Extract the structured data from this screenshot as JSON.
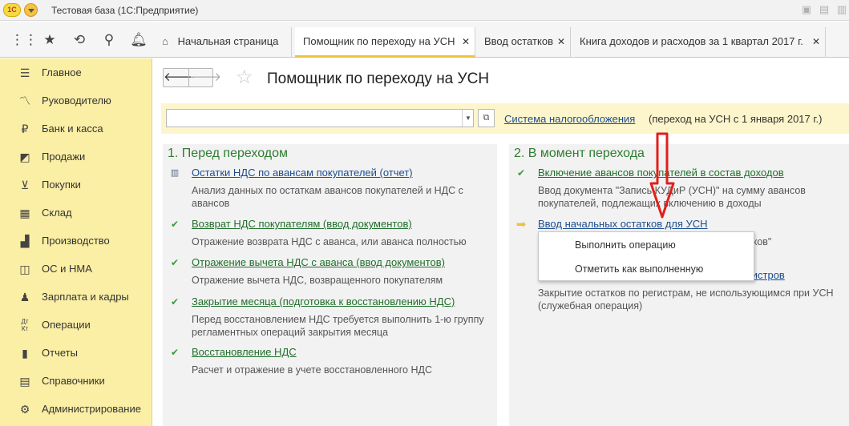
{
  "titlebar": {
    "logo": "1С",
    "title": "Тестовая база  (1С:Предприятие)"
  },
  "tabs": [
    {
      "label": "Начальная страница"
    },
    {
      "label": "Помощник по переходу на УСН"
    },
    {
      "label": "Ввод остатков"
    },
    {
      "label": "Книга доходов и расходов за 1 квартал 2017 г."
    }
  ],
  "sidebar": {
    "items": [
      {
        "label": "Главное",
        "icon": "menu-icon"
      },
      {
        "label": "Руководителю",
        "icon": "chart-line-icon"
      },
      {
        "label": "Банк и касса",
        "icon": "ruble-icon"
      },
      {
        "label": "Продажи",
        "icon": "bag-icon"
      },
      {
        "label": "Покупки",
        "icon": "cart-icon"
      },
      {
        "label": "Склад",
        "icon": "warehouse-icon"
      },
      {
        "label": "Производство",
        "icon": "factory-icon"
      },
      {
        "label": "ОС и НМА",
        "icon": "assets-icon"
      },
      {
        "label": "Зарплата и кадры",
        "icon": "people-icon"
      },
      {
        "label": "Операции",
        "icon": "dt-kt-icon"
      },
      {
        "label": "Отчеты",
        "icon": "reports-icon"
      },
      {
        "label": "Справочники",
        "icon": "book-icon"
      },
      {
        "label": "Администрирование",
        "icon": "gear-icon"
      }
    ]
  },
  "main": {
    "title": "Помощник по переходу на УСН",
    "tax_link": "Система налогообложения",
    "tax_note": "(переход на УСН с 1 января 2017 г.)",
    "left": {
      "title": "1. Перед переходом",
      "steps": [
        {
          "title": "Остатки НДС по авансам покупателей (отчет)",
          "desc": [
            "Анализ данных по остаткам авансов покупателей и НДС с",
            "авансов"
          ]
        },
        {
          "title": "Возврат НДС покупателям (ввод документов)",
          "desc": [
            "Отражение возврата НДС с аванса, или аванса полностью"
          ]
        },
        {
          "title": "Отражение вычета НДС с аванса (ввод документов)",
          "desc": [
            "Отражение вычета НДС, возвращенного покупателям"
          ]
        },
        {
          "title": "Закрытие месяца (подготовка к восстановлению НДС)",
          "desc": [
            "Перед восстановлением НДС требуется выполнить 1-ю группу",
            "регламентных операций закрытия месяца"
          ]
        },
        {
          "title": "Восстановление НДС",
          "desc": [
            "Расчет и отражение в учете восстановленного НДС"
          ]
        }
      ]
    },
    "right": {
      "title": "2. В момент перехода",
      "steps": [
        {
          "title": "Включение авансов покупателей в состав доходов",
          "desc": [
            "Ввод документа \"Запись КУДиР (УСН)\" на сумму авансов",
            "покупателей, подлежащих включению в доходы"
          ]
        },
        {
          "title": "Ввод начальных остатков для УСН",
          "desc_tail": "тков\""
        },
        {
          "title_tail": "гистров",
          "desc": [
            "Закрытие остатков по  регистрам, не использующимся при УСН",
            "(служебная операция)"
          ]
        }
      ]
    },
    "popup": [
      "Выполнить операцию",
      "Отметить как выполненную"
    ]
  },
  "colors": {
    "accent": "#f0c23c",
    "sidebar_bg": "#fbeea5",
    "link_blue": "#1c4d8f",
    "done_green": "#1f6f2a",
    "annotation_red": "#e0201c"
  }
}
